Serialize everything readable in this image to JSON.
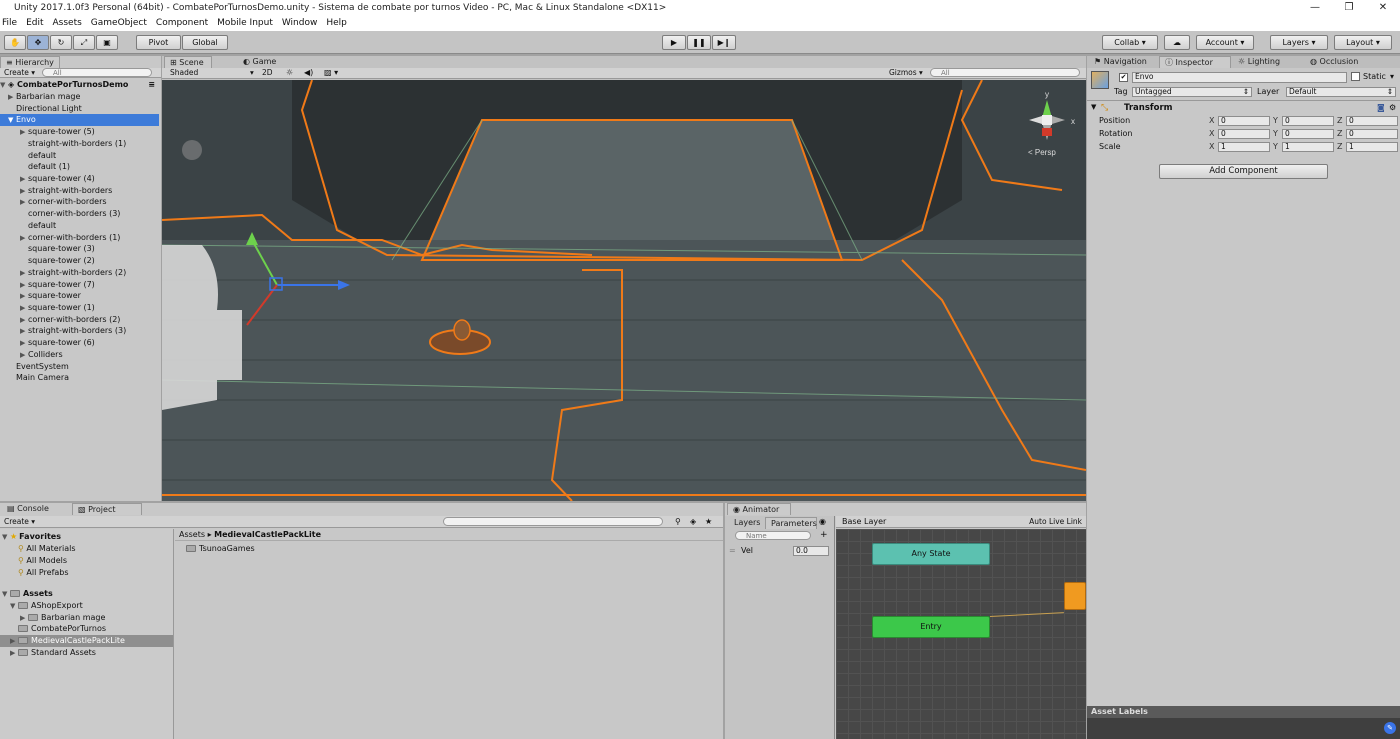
{
  "window": {
    "title": "Unity 2017.1.0f3 Personal (64bit) - CombatePorTurnosDemo.unity - Sistema de combate por turnos Video - PC, Mac & Linux Standalone <DX11>"
  },
  "menu": [
    "File",
    "Edit",
    "Assets",
    "GameObject",
    "Component",
    "Mobile Input",
    "Window",
    "Help"
  ],
  "toolbar": {
    "pivot": "Pivot",
    "global": "Global",
    "collab": "Collab ▾",
    "account": "Account",
    "layers": "Layers",
    "layout": "Layout"
  },
  "hierarchy": {
    "tab": "Hierarchy",
    "create": "Create ▾",
    "search": "All",
    "scene": "CombatePorTurnosDemo",
    "items": [
      {
        "label": "Barbarian mage",
        "indent": 1,
        "arrow": "▶"
      },
      {
        "label": "Directional Light",
        "indent": 1,
        "arrow": ""
      },
      {
        "label": "Envo",
        "indent": 1,
        "arrow": "▼",
        "selected": true
      },
      {
        "label": "square-tower (5)",
        "indent": 2,
        "arrow": "▶"
      },
      {
        "label": "straight-with-borders (1)",
        "indent": 2,
        "arrow": ""
      },
      {
        "label": "default",
        "indent": 2,
        "arrow": ""
      },
      {
        "label": "default (1)",
        "indent": 2,
        "arrow": ""
      },
      {
        "label": "square-tower (4)",
        "indent": 2,
        "arrow": "▶"
      },
      {
        "label": "straight-with-borders",
        "indent": 2,
        "arrow": "▶"
      },
      {
        "label": "corner-with-borders",
        "indent": 2,
        "arrow": "▶"
      },
      {
        "label": "corner-with-borders (3)",
        "indent": 2,
        "arrow": ""
      },
      {
        "label": "default",
        "indent": 2,
        "arrow": ""
      },
      {
        "label": "corner-with-borders (1)",
        "indent": 2,
        "arrow": "▶"
      },
      {
        "label": "square-tower (3)",
        "indent": 2,
        "arrow": ""
      },
      {
        "label": "square-tower (2)",
        "indent": 2,
        "arrow": ""
      },
      {
        "label": "straight-with-borders (2)",
        "indent": 2,
        "arrow": "▶"
      },
      {
        "label": "square-tower (7)",
        "indent": 2,
        "arrow": "▶"
      },
      {
        "label": "square-tower",
        "indent": 2,
        "arrow": "▶"
      },
      {
        "label": "square-tower (1)",
        "indent": 2,
        "arrow": "▶"
      },
      {
        "label": "corner-with-borders (2)",
        "indent": 2,
        "arrow": "▶"
      },
      {
        "label": "straight-with-borders (3)",
        "indent": 2,
        "arrow": "▶"
      },
      {
        "label": "square-tower (6)",
        "indent": 2,
        "arrow": "▶"
      },
      {
        "label": "Colliders",
        "indent": 2,
        "arrow": "▶"
      },
      {
        "label": "EventSystem",
        "indent": 1,
        "arrow": ""
      },
      {
        "label": "Main Camera",
        "indent": 1,
        "arrow": ""
      }
    ]
  },
  "scene": {
    "tab_scene": "Scene",
    "tab_game": "Game",
    "shaded": "Shaded",
    "mode2d": "2D",
    "gizmos": "Gizmos ▾",
    "search": "All",
    "persp": "< Persp",
    "axis_y": "y",
    "axis_x": "x"
  },
  "inspector": {
    "tabs": [
      "Navigation",
      "Inspector",
      "Lighting",
      "Occlusion"
    ],
    "name": "Envo",
    "static": "Static",
    "tag_label": "Tag",
    "tag_value": "Untagged",
    "layer_label": "Layer",
    "layer_value": "Default",
    "component": "Transform",
    "rows": [
      {
        "label": "Position",
        "x": "0",
        "y": "0",
        "z": "0"
      },
      {
        "label": "Rotation",
        "x": "0",
        "y": "0",
        "z": "0"
      },
      {
        "label": "Scale",
        "x": "1",
        "y": "1",
        "z": "1"
      }
    ],
    "axis": {
      "x": "X",
      "y": "Y",
      "z": "Z"
    },
    "add_component": "Add Component",
    "asset_labels": "Asset Labels"
  },
  "project": {
    "tab_console": "Console",
    "tab_project": "Project",
    "create": "Create ▾",
    "favorites": "Favorites",
    "fav_items": [
      "All Materials",
      "All Models",
      "All Prefabs"
    ],
    "assets": "Assets",
    "asset_items": [
      {
        "label": "AShopExport",
        "indent": 1,
        "arrow": "▼"
      },
      {
        "label": "Barbarian mage",
        "indent": 2,
        "arrow": "▶"
      },
      {
        "label": "CombatePorTurnos",
        "indent": 1,
        "arrow": ""
      },
      {
        "label": "MedievalCastlePackLite",
        "indent": 1,
        "arrow": "▶",
        "selected": true
      },
      {
        "label": "Standard Assets",
        "indent": 1,
        "arrow": "▶"
      }
    ],
    "breadcrumb_root": "Assets",
    "breadcrumb_sep": "▸",
    "breadcrumb_current": "MedievalCastlePackLite",
    "content": [
      "TsunoaGames"
    ]
  },
  "animator": {
    "tab": "Animator",
    "layers": "Layers",
    "parameters": "Parameters",
    "search": "Name",
    "param_name": "Vel",
    "param_value": "0.0",
    "base_layer": "Base Layer",
    "auto_live": "Auto Live Link",
    "any_state": "Any State",
    "entry": "Entry"
  }
}
